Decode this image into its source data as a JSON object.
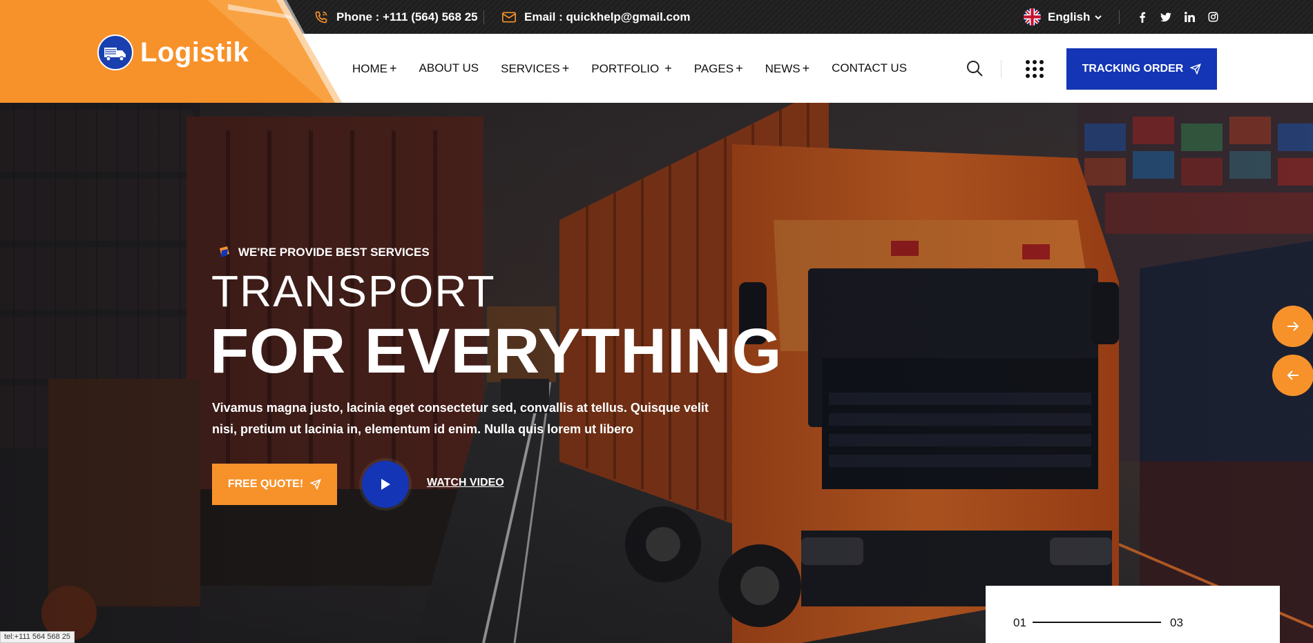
{
  "topbar": {
    "phone": "Phone : +111 (564) 568 25",
    "email": "Email : quickhelp@gmail.com",
    "language": "English",
    "icons": {
      "phone": "phone-icon",
      "email": "mail-icon",
      "flag": "uk-flag-icon",
      "chevron": "chevron-down-icon"
    },
    "socials": [
      "facebook-icon",
      "twitter-icon",
      "linkedin-icon",
      "instagram-icon"
    ]
  },
  "header": {
    "logo_text": "Logistik",
    "nav": [
      {
        "label": "HOME",
        "has_sub": true
      },
      {
        "label": "ABOUT US",
        "has_sub": false
      },
      {
        "label": "SERVICES",
        "has_sub": true
      },
      {
        "label": "PORTFOLIO",
        "has_sub": true
      },
      {
        "label": "PAGES",
        "has_sub": true
      },
      {
        "label": "NEWS",
        "has_sub": true
      },
      {
        "label": "CONTACT US",
        "has_sub": false
      }
    ],
    "plus": "+",
    "tracking_label": "TRACKING ORDER"
  },
  "hero": {
    "tagline": "WE'RE PROVIDE BEST SERVICES",
    "title_line1": "TRANSPORT",
    "title_line2": "FOR EVERYTHING",
    "description": "Vivamus magna justo, lacinia eget consectetur sed, convallis at tellus. Quisque velit nisi, pretium ut lacinia in, elementum id enim. Nulla quis lorem ut libero",
    "quote_label": "FREE QUOTE!",
    "watch_label": "WATCH VIDEO",
    "slide_current": "01",
    "slide_total": "03"
  },
  "status_url": "tel:+111 564 568 25",
  "colors": {
    "accent": "#f7922b",
    "primary": "#1435b5",
    "dark": "#1e1e1e"
  }
}
